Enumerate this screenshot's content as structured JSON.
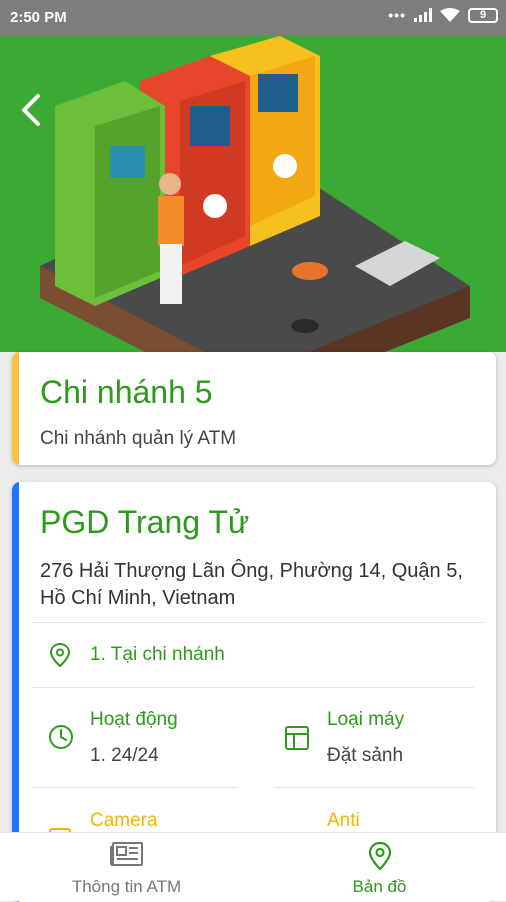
{
  "status_bar": {
    "time": "2:50 PM",
    "battery_level": "9"
  },
  "hero": {
    "back_icon": "chevron-left-icon",
    "illustration": "atm-illustration"
  },
  "branch_card": {
    "title": "Chi nhánh 5",
    "subtitle": "Chi nhánh quản lý ATM",
    "accent": "#f9c23c"
  },
  "atm_card": {
    "title": "PGD Trang Tử",
    "address": "276 Hải Thượng Lãn Ông, Phường 14, Quận 5, Hồ Chí Minh, Vietnam",
    "accent": "#1f75fe",
    "location_text": "1. Tại chi nhánh",
    "hours_label": "Hoạt động",
    "hours_value": "1. 24/24",
    "machine_label": "Loại máy",
    "machine_value": "Đặt sảnh",
    "camera_label": "Camera",
    "anti_label": "Anti"
  },
  "bottom_nav": {
    "items": [
      {
        "label": "Thông tin ATM",
        "icon": "newspaper-icon",
        "active": false
      },
      {
        "label": "Bản đồ",
        "icon": "map-pin-icon",
        "active": true
      }
    ],
    "active_color": "#2e9a1d",
    "inactive_color": "#777777"
  },
  "colors": {
    "primary_green": "#2e9a1d",
    "hero_green": "#3aaa35",
    "warning_yellow": "#f4b400"
  }
}
